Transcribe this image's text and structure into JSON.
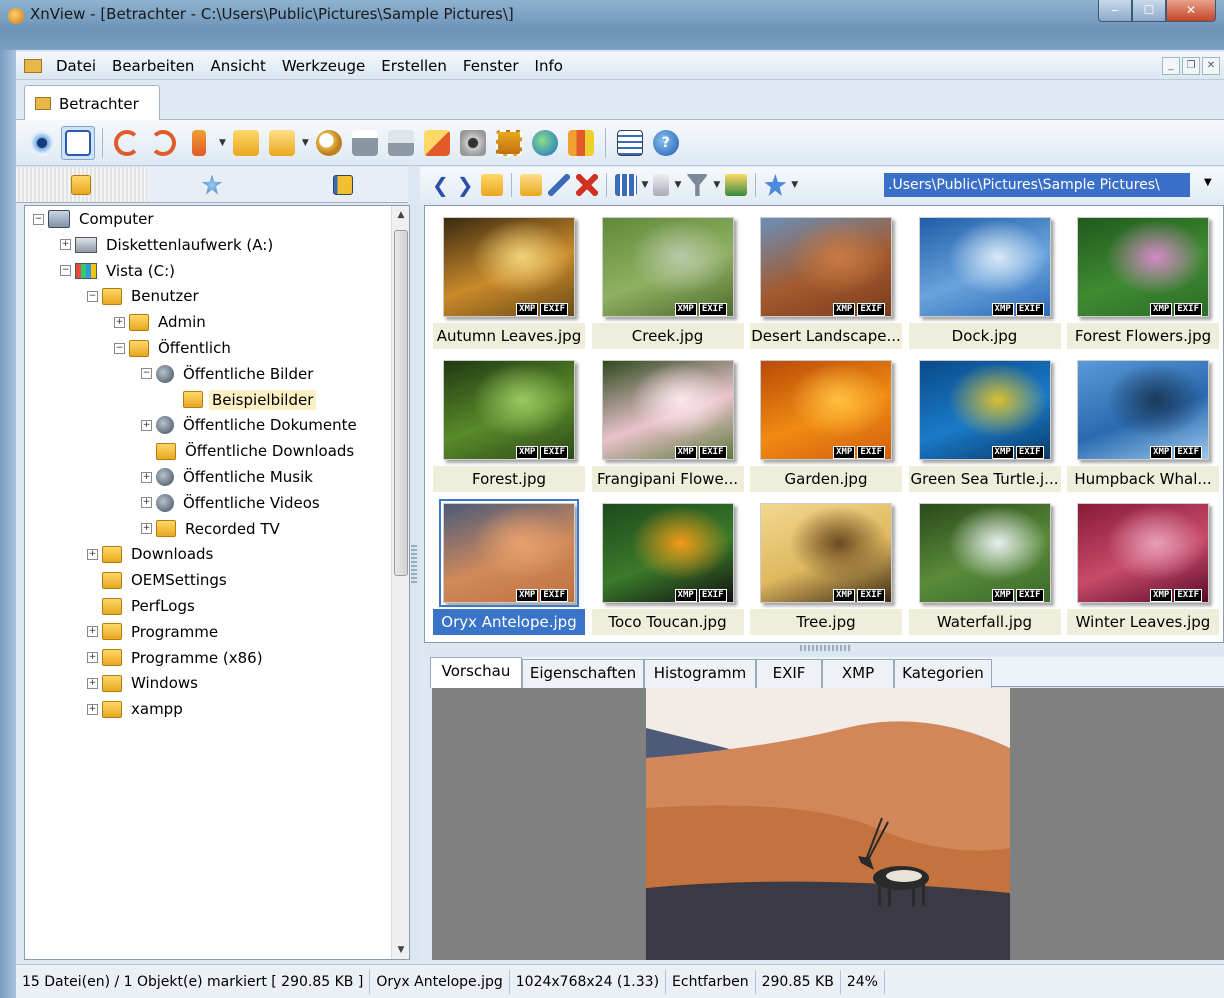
{
  "window": {
    "title": "XnView - [Betrachter - C:\\Users\\Public\\Pictures\\Sample Pictures\\]",
    "minimize": "‒",
    "maximize": "☐",
    "close": "✕"
  },
  "menu": {
    "items": [
      "Datei",
      "Bearbeiten",
      "Ansicht",
      "Werkzeuge",
      "Erstellen",
      "Fenster",
      "Info"
    ],
    "mdi": [
      "_",
      "❐",
      "✕"
    ]
  },
  "tab": {
    "label": "Betrachter"
  },
  "toolbar": {
    "icons": [
      "eye-icon",
      "fullscreen-icon",
      "rotate-left-icon",
      "rotate-right-icon",
      "refresh-icon",
      "folder-open-icon",
      "folder-move-icon",
      "find-icon",
      "print-icon",
      "scanner-icon",
      "convert-icon",
      "camera-icon",
      "slideshow-icon",
      "web-icon",
      "contact-sheet-icon",
      "options-icon",
      "help-icon"
    ]
  },
  "left_tabs": [
    "folders-tab-icon",
    "favorites-tab-icon",
    "categories-tab-icon"
  ],
  "tree": [
    {
      "label": "Computer",
      "icon": "computer",
      "exp": "−",
      "level": 0
    },
    {
      "label": "Diskettenlaufwerk (A:)",
      "icon": "drive",
      "exp": "+",
      "level": 1
    },
    {
      "label": "Vista (C:)",
      "icon": "vista",
      "exp": "−",
      "level": 1
    },
    {
      "label": "Benutzer",
      "icon": "folder",
      "exp": "−",
      "level": 2
    },
    {
      "label": "Admin",
      "icon": "folder",
      "exp": "+",
      "level": 3
    },
    {
      "label": "Öffentlich",
      "icon": "folder",
      "exp": "−",
      "level": 3
    },
    {
      "label": "Öffentliche Bilder",
      "icon": "media",
      "exp": "−",
      "level": 4
    },
    {
      "label": "Beispielbilder",
      "icon": "folder",
      "exp": "",
      "level": 5,
      "selected": true
    },
    {
      "label": "Öffentliche Dokumente",
      "icon": "media",
      "exp": "+",
      "level": 4
    },
    {
      "label": "Öffentliche Downloads",
      "icon": "folder",
      "exp": "",
      "level": 4
    },
    {
      "label": "Öffentliche Musik",
      "icon": "media",
      "exp": "+",
      "level": 4
    },
    {
      "label": "Öffentliche Videos",
      "icon": "media",
      "exp": "+",
      "level": 4
    },
    {
      "label": "Recorded TV",
      "icon": "folder",
      "exp": "+",
      "level": 4
    },
    {
      "label": "Downloads",
      "icon": "folder",
      "exp": "+",
      "level": 2
    },
    {
      "label": "OEMSettings",
      "icon": "folder",
      "exp": "",
      "level": 2
    },
    {
      "label": "PerfLogs",
      "icon": "folder",
      "exp": "",
      "level": 2
    },
    {
      "label": "Programme",
      "icon": "folder",
      "exp": "+",
      "level": 2
    },
    {
      "label": "Programme (x86)",
      "icon": "folder",
      "exp": "+",
      "level": 2
    },
    {
      "label": "Windows",
      "icon": "folder",
      "exp": "+",
      "level": 2
    },
    {
      "label": "xampp",
      "icon": "folder",
      "exp": "+",
      "level": 2
    }
  ],
  "navbar": {
    "path": ".Users\\Public\\Pictures\\Sample Pictures\\",
    "back": "❮",
    "forward": "❯"
  },
  "thumbnails": [
    {
      "name": "Autumn Leaves.jpg",
      "colors": [
        "#3a2a10",
        "#c98a2a",
        "#f3d27a",
        "#6b4a18"
      ]
    },
    {
      "name": "Creek.jpg",
      "colors": [
        "#5f8a3a",
        "#8fb062",
        "#b9c9a8",
        "#4d6b2c"
      ]
    },
    {
      "name": "Desert Landscape...",
      "colors": [
        "#6a8fb8",
        "#a35a2e",
        "#c97a42",
        "#7a3c1c"
      ]
    },
    {
      "name": "Dock.jpg",
      "colors": [
        "#1f5ca8",
        "#6aa3dc",
        "#d8e9f7",
        "#2a6ab8"
      ]
    },
    {
      "name": "Forest Flowers.jpg",
      "colors": [
        "#1f5a1c",
        "#3f8a32",
        "#d48ac6",
        "#2b6e26"
      ]
    },
    {
      "name": "Forest.jpg",
      "colors": [
        "#1e3a12",
        "#5a8a2a",
        "#9bc860",
        "#2c4a18"
      ]
    },
    {
      "name": "Frangipani Flowe...",
      "colors": [
        "#2e4a1e",
        "#e9c2cc",
        "#fbe7ec",
        "#5a7a3a"
      ]
    },
    {
      "name": "Garden.jpg",
      "colors": [
        "#b84a08",
        "#f08a12",
        "#ffc040",
        "#d06010"
      ]
    },
    {
      "name": "Green Sea Turtle.j...",
      "colors": [
        "#0a4a8a",
        "#1a7ac8",
        "#d8c030",
        "#0a3a6a"
      ]
    },
    {
      "name": "Humpback Whal...",
      "colors": [
        "#5a9ad8",
        "#2a6ab0",
        "#1a3a5a",
        "#9ac8ec"
      ]
    },
    {
      "name": "Oryx Antelope.jpg",
      "colors": [
        "#4a5a7a",
        "#d08a5a",
        "#e8a070",
        "#c07040"
      ],
      "selected": true
    },
    {
      "name": "Toco Toucan.jpg",
      "colors": [
        "#1e4a1e",
        "#3a7a2a",
        "#f09a18",
        "#111111"
      ]
    },
    {
      "name": "Tree.jpg",
      "colors": [
        "#f2d890",
        "#e0b860",
        "#6a4a20",
        "#3a2a10"
      ]
    },
    {
      "name": "Waterfall.jpg",
      "colors": [
        "#2a4a1a",
        "#5a8a3a",
        "#e8f0f0",
        "#3a6a2a"
      ]
    },
    {
      "name": "Winter Leaves.jpg",
      "colors": [
        "#8a1a3a",
        "#c84a6a",
        "#e8a0b8",
        "#5a0a2a"
      ]
    }
  ],
  "badges": {
    "xmp": "XMP",
    "exif": "EXIF"
  },
  "bottom_tabs": [
    "Vorschau",
    "Eigenschaften",
    "Histogramm",
    "EXIF",
    "XMP",
    "Kategorien"
  ],
  "status": {
    "files": "15 Datei(en) / 1 Objekt(e) markiert  [ 290.85 KB ]",
    "filename": "Oryx Antelope.jpg",
    "dimensions": "1024x768x24 (1.33)",
    "colors": "Echtfarben",
    "size": "290.85 KB",
    "zoom": "24%"
  },
  "tree_scroll": {
    "up": "▲",
    "down": "▼"
  }
}
